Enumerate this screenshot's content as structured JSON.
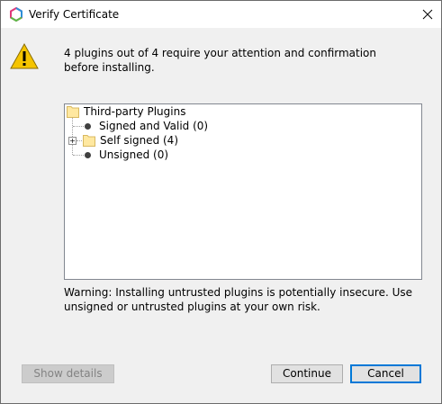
{
  "window": {
    "title": "Verify Certificate"
  },
  "message": "4 plugins out of 4 require your attention and confirmation before installing.",
  "tree": {
    "root": "Third-party Plugins",
    "children": [
      {
        "label": "Signed and Valid (0)",
        "icon": "bullet-icon",
        "expandable": false
      },
      {
        "label": "Self signed (4)",
        "icon": "folder-icon",
        "expandable": true
      },
      {
        "label": "Unsigned (0)",
        "icon": "bullet-icon",
        "expandable": false
      }
    ]
  },
  "warning": "Warning: Installing untrusted plugins is potentially insecure. Use unsigned or untrusted plugins at your own risk.",
  "buttons": {
    "show_details": "Show details",
    "continue": "Continue",
    "cancel": "Cancel"
  },
  "colors": {
    "accent": "#0078d7",
    "folder": "#ffe8a0",
    "warning_yellow": "#f5c400"
  }
}
